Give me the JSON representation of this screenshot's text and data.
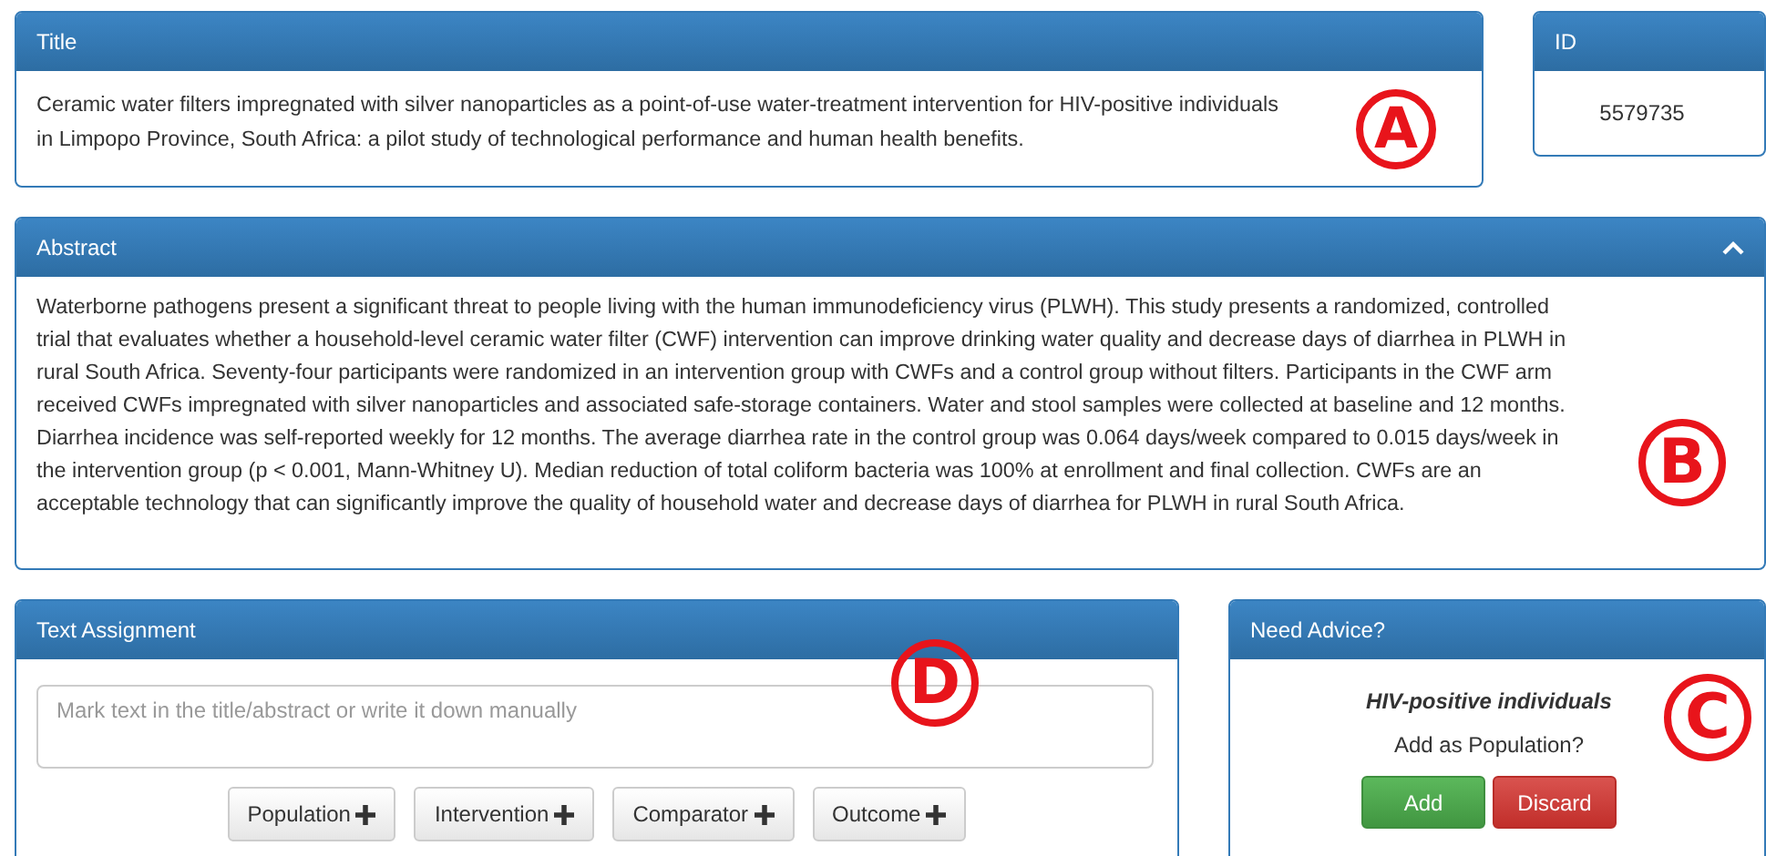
{
  "title_panel": {
    "heading": "Title",
    "text": "Ceramic water filters impregnated with silver nanoparticles as a point-of-use water-treatment intervention for HIV-positive individuals in Limpopo Province, South Africa: a pilot study of technological performance and human health benefits.",
    "marker": "A"
  },
  "id_panel": {
    "heading": "ID",
    "value": "5579735"
  },
  "abstract_panel": {
    "heading": "Abstract",
    "expanded": true,
    "text": "Waterborne pathogens present a significant threat to people living with the human immunodeficiency virus (PLWH). This study presents a randomized, controlled trial that evaluates whether a household-level ceramic water filter (CWF) intervention can improve drinking water quality and decrease days of diarrhea in PLWH in rural South Africa. Seventy-four participants were randomized in an intervention group with CWFs and a control group without filters. Participants in the CWF arm received CWFs impregnated with silver nanoparticles and associated safe-storage containers. Water and stool samples were collected at baseline and 12 months. Diarrhea incidence was self-reported weekly for 12 months. The average diarrhea rate in the control group was 0.064 days/week compared to 0.015 days/week in the intervention group (p < 0.001, Mann-Whitney U). Median reduction of total coliform bacteria was 100% at enrollment and final collection. CWFs are an acceptable technology that can significantly improve the quality of household water and decrease days of diarrhea for PLWH in rural South Africa.",
    "marker": "B"
  },
  "assignment_panel": {
    "heading": "Text Assignment",
    "placeholder": "Mark text in the title/abstract or write it down manually",
    "buttons": [
      "Population",
      "Intervention",
      "Comparator",
      "Outcome"
    ],
    "marker": "D"
  },
  "advice_panel": {
    "heading": "Need Advice?",
    "phrase": "HIV-positive individuals",
    "question": "Add as Population?",
    "buttons": [
      {
        "label": "Add",
        "kind": "confirm"
      },
      {
        "label": "Discard",
        "kind": "reject"
      }
    ],
    "marker": "C"
  }
}
